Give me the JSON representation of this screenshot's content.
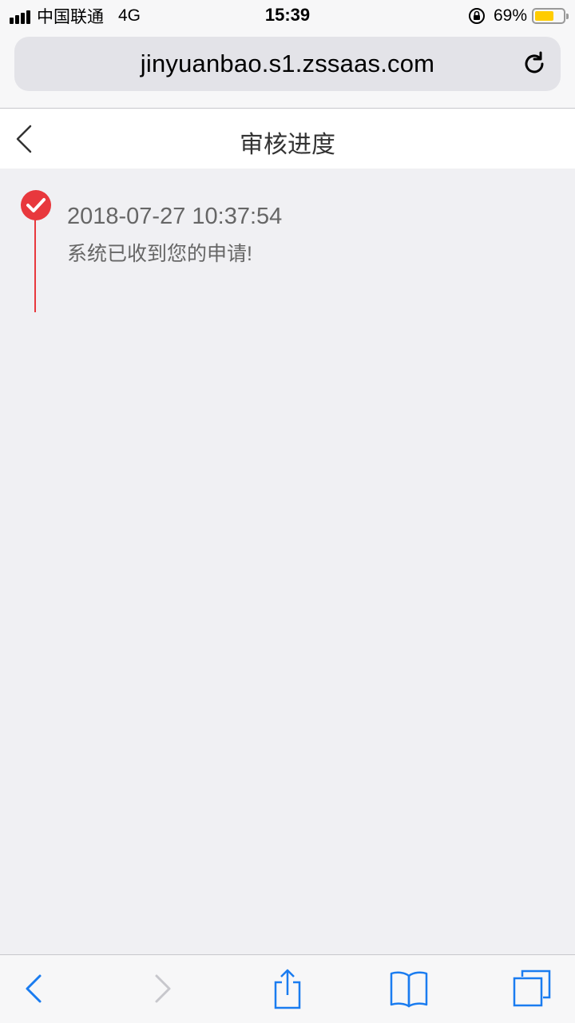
{
  "status_bar": {
    "carrier": "中国联通",
    "network": "4G",
    "time": "15:39",
    "battery_percent": "69%",
    "battery_level": 0.69
  },
  "browser": {
    "url": "jinyuanbao.s1.zssaas.com",
    "icons": {
      "reload": "reload-icon",
      "back": "back-arrow-icon",
      "forward": "forward-arrow-icon",
      "share": "share-icon",
      "bookmarks": "bookmarks-icon",
      "tabs": "tabs-icon"
    },
    "accent_color": "#1a7cf0"
  },
  "page": {
    "title": "审核进度",
    "timeline": [
      {
        "time": "2018-07-27 10:37:54",
        "message": "系统已收到您的申请!",
        "status_icon": "check-circle-icon",
        "color": "#e8383d"
      }
    ]
  }
}
